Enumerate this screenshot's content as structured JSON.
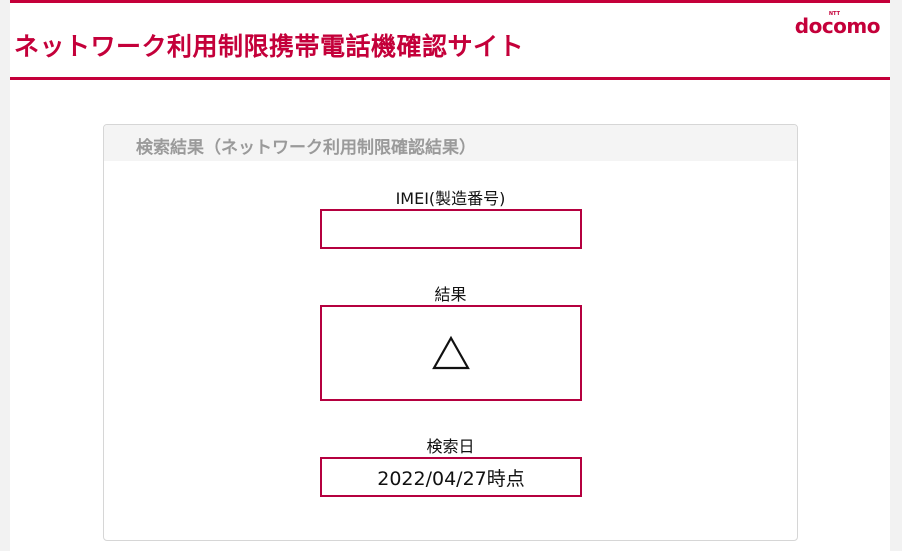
{
  "header": {
    "title": "ネットワーク利用制限携帯電話機確認サイト",
    "brand": {
      "top": "NTT",
      "name": "docomo"
    }
  },
  "panel": {
    "title": "検索結果（ネットワーク利用制限確認結果）",
    "imei_label": "IMEI(製造番号)",
    "imei_value": "",
    "result_label": "結果",
    "result_symbol": "triangle-icon",
    "date_label": "検索日",
    "date_value": "2022/04/27時点"
  },
  "colors": {
    "accent": "#c4003a",
    "box_border": "#b5003f",
    "panel_header_bg": "#f4f4f4",
    "panel_title": "#9a9a9a"
  }
}
